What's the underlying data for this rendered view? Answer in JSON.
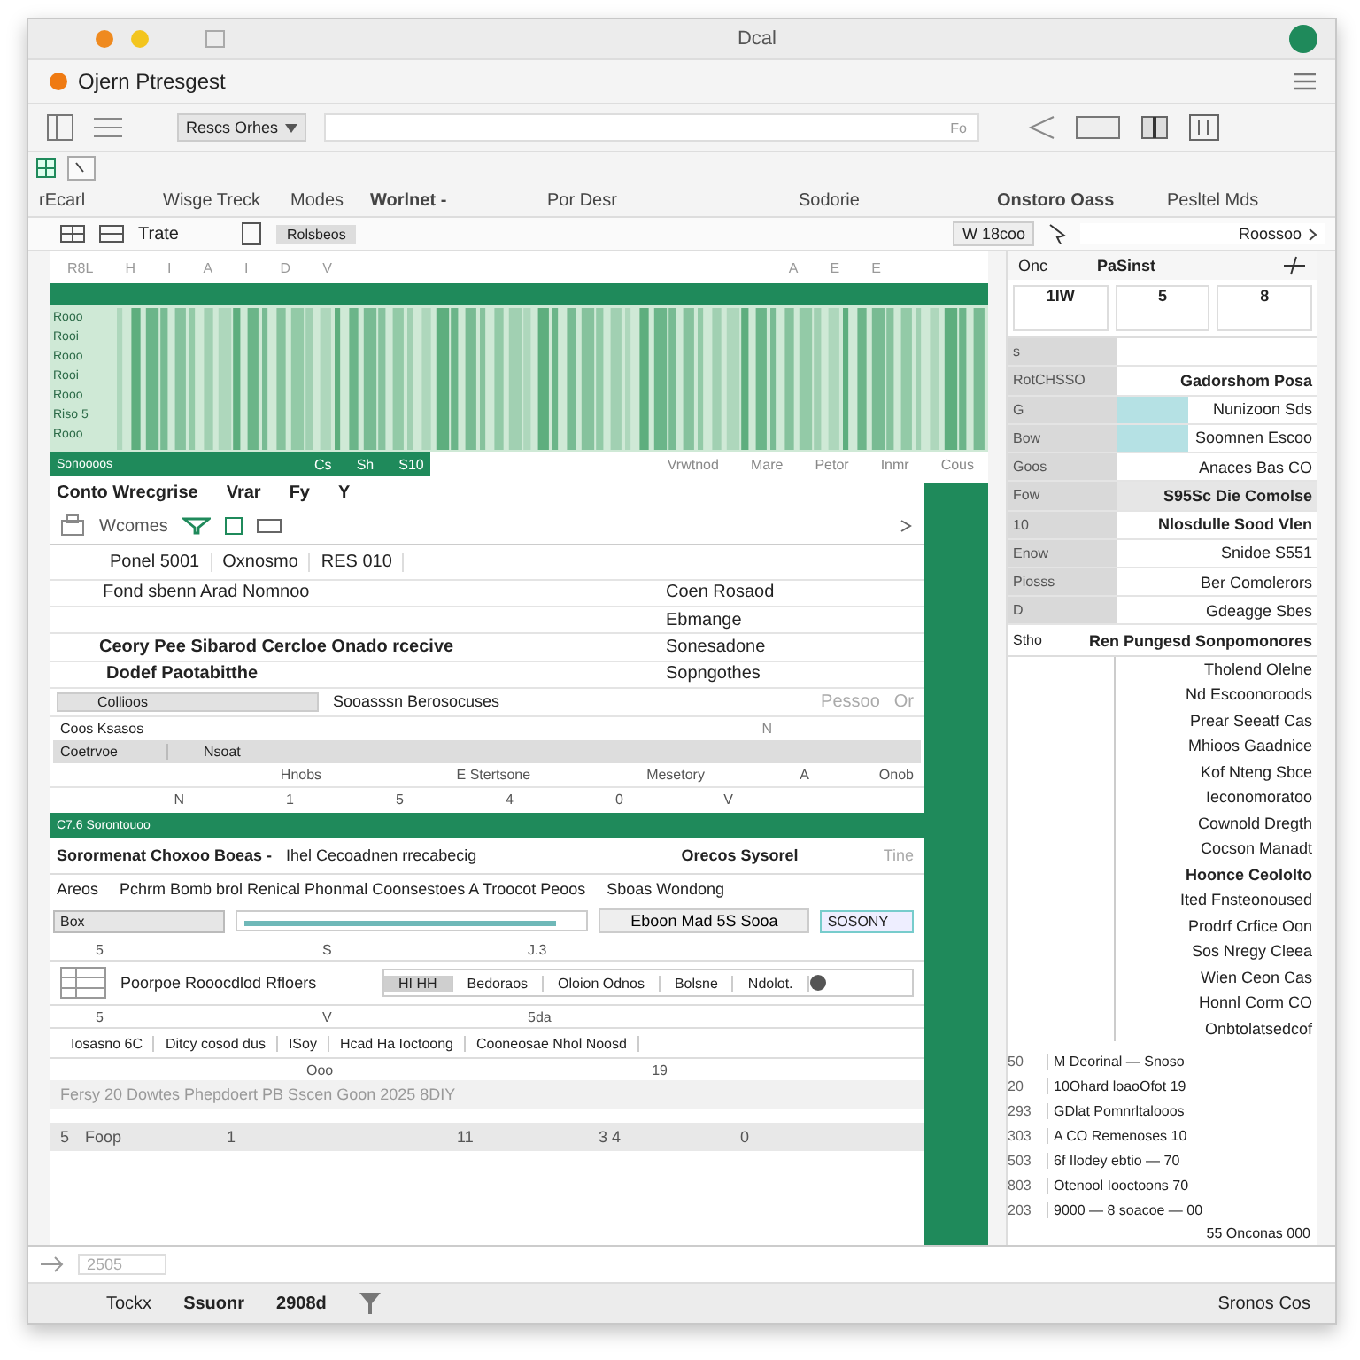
{
  "window": {
    "title": "Dcal"
  },
  "app": {
    "title": "Ojern Ptresgest"
  },
  "toolbar": {
    "dropdown": "Rescs Orhes",
    "field_hint": "Fo"
  },
  "menu": [
    "rEcarl",
    "Wisge Treck",
    "Modes",
    "Worlnet -",
    "Por Desr",
    "Sodorie",
    "Onstoro Oass",
    "Pesltel Mds"
  ],
  "subtoolbar": {
    "label": "Trate",
    "chip": "Rolsbeos",
    "field": "W 18coo",
    "menu_label": "Roossoo"
  },
  "sheet": {
    "column_headers": [
      "R8L",
      "H",
      "I",
      "A",
      "I",
      "D",
      "V",
      "A",
      "E",
      "E"
    ],
    "row_labels": [
      "Rooo",
      "Rooi",
      "Rooo",
      "Rooi",
      "Rooo",
      "Riso 5",
      "Rooo"
    ],
    "footer_left": "Sonoooos",
    "footer_marks": [
      "Cs",
      "Sh",
      "S10"
    ],
    "footer_tabs": [
      "Vrwtnod",
      "Mare",
      "Petor",
      "Inmr",
      "Cous"
    ]
  },
  "card": {
    "title": "Conto Wrecgrise",
    "tools": [
      "Vrar",
      "Fy",
      "Y"
    ],
    "filter_label": "Wcomes",
    "checked": false,
    "fields": [
      "Ponel 5001",
      "Oxnosmo",
      "RES 010"
    ],
    "lines": [
      {
        "left": "Fond sbenn Arad Nomnoo",
        "right": "Coen Rosaod"
      },
      {
        "right": "Ebmange"
      },
      {
        "left": "Ceory Pee Sibarod Cercloe Onado rcecive",
        "right": "Sonesadone"
      },
      {
        "left": "Dodef Paotabitthe",
        "right": "Sopngothes"
      }
    ],
    "chip": "Collioos",
    "chip_text": "Sooasssn Berosocuses",
    "chip_right": [
      "Pessoo",
      "Or"
    ],
    "group_label": "Coos Ksasos",
    "group_mark": "N",
    "bar": [
      "Coetrvoe",
      "Nsoat"
    ],
    "heads": [
      "Hnobs",
      "E Stertsone",
      "Mesetory",
      "A",
      "Onob"
    ],
    "values": [
      "N",
      "1",
      "5",
      "4",
      "0",
      "V"
    ]
  },
  "band": {
    "title": "C7.6 Sorontouoo"
  },
  "lower": {
    "heads": [
      "Sorormenat Choxoo Boeas -",
      "Ihel Cecoadnen rrecabecig",
      "Orecos Sysorel",
      "Tine"
    ],
    "area_label": "Areos",
    "sentence": "Pchrm Bomb brol Renical Phonmal Coonsestoes A Troocot Peoos",
    "sentence_right": "Sboas Wondong",
    "box": "Box",
    "level": 0.93,
    "button": "Eboon Mad 5S Sooa",
    "teal_field": "SOSONY",
    "marks1": [
      "5",
      "S",
      "J.3"
    ],
    "list_title": "Poorpoe Rooocdlod Rfloers",
    "tabs": [
      {
        "label": "HI HH",
        "selected": true
      },
      {
        "label": "Bedoraos",
        "selected": false
      },
      {
        "label": "Oloion Odnos",
        "selected": false
      },
      {
        "label": "Bolsne",
        "selected": false
      },
      {
        "label": "Ndolot.",
        "selected": false
      }
    ],
    "marks2": [
      "5",
      "V",
      "5da"
    ],
    "cells": [
      "Iosasno 6C",
      "Ditcy cosod dus",
      "ISoy",
      "Hcad Ha Ioctoong",
      "Cooneosae Nhol Noosd"
    ],
    "marks3": [
      "Ooo",
      "19"
    ],
    "note": "Fersy 20 Dowtes Phepdoert PB Sscen Goon 2025 8DIY",
    "totals": [
      "5",
      "Foop",
      "1",
      "11",
      "3 4",
      "0"
    ]
  },
  "panel": {
    "header": [
      "Onc",
      "PaSinst"
    ],
    "small": [
      "1IW",
      "5",
      "8"
    ],
    "rows": [
      {
        "label": "s",
        "kind": "plain"
      },
      {
        "label": "RotCHSSO",
        "value": "Gadorshom Posa",
        "kind": "bold"
      },
      {
        "label": "G",
        "value": "Nunizoon Sds",
        "kind": "teal"
      },
      {
        "label": "Bow",
        "value": "Soomnen Escoo",
        "kind": "teal"
      },
      {
        "label": "Goos",
        "value": "Anaces Bas CO",
        "kind": "plain"
      },
      {
        "label": "Fow",
        "value": "S95Sc Die Comolse",
        "kind": "band"
      },
      {
        "label": "10",
        "value": "Nlosdulle Sood Vlen",
        "kind": "bold"
      },
      {
        "label": "Enow",
        "value": "Snidoe S551",
        "kind": "plain"
      },
      {
        "label": "Piosss",
        "value": "Ber Comolerors",
        "kind": "plain"
      },
      {
        "label": "D",
        "value": "Gdeagge Sbes",
        "kind": "plain"
      }
    ],
    "section": [
      "Stho",
      "Ren Pungesd Sonpomonores"
    ],
    "list": [
      {
        "text": "Tholend Olelne",
        "bold": false
      },
      {
        "text": "Nd Escoonoroods",
        "bold": false
      },
      {
        "text": "Prear Seeatf Cas",
        "bold": false
      },
      {
        "text": "Mhioos Gaadnice",
        "bold": false
      },
      {
        "text": "Kof Nteng Sbce",
        "bold": false
      },
      {
        "text": "Ieconomoratoo",
        "bold": false
      },
      {
        "text": "Cownold Dregth",
        "bold": false
      },
      {
        "text": "Cocson Manadt",
        "bold": false
      },
      {
        "text": "Hoonce Ceololto",
        "bold": true
      },
      {
        "text": "Ited Fnsteonoused",
        "bold": false
      },
      {
        "text": "Prodrf Crfice Oon",
        "bold": false
      },
      {
        "text": "Sos Nregy Cleea",
        "bold": false
      },
      {
        "text": "Wien Ceon Cas",
        "bold": false
      },
      {
        "text": "Honnl Corm CO",
        "bold": false
      },
      {
        "text": "Onbtolatsedcof",
        "bold": false
      }
    ],
    "numbered": [
      {
        "num": "50",
        "text": "M Deorinal — Snoso"
      },
      {
        "num": "20",
        "text": "10Ohard loaoOfot 19"
      },
      {
        "num": "293",
        "text": "GDlat Pomnrltalooos"
      },
      {
        "num": "303",
        "text": "A CO Remenoses 10"
      },
      {
        "num": "503",
        "text": "6f Ilodey ebtio — 70"
      },
      {
        "num": "803",
        "text": "Otenool Iooctoons 70"
      },
      {
        "num": "203",
        "text": "9000 — 8 soacoe — 00"
      }
    ],
    "footer": "55 Onconas 000"
  },
  "bottom": {
    "field": "2505"
  },
  "status_bar": {
    "items": [
      "Tockx",
      "Ssuonr",
      "2908d"
    ],
    "right": "Sronos Cos"
  }
}
